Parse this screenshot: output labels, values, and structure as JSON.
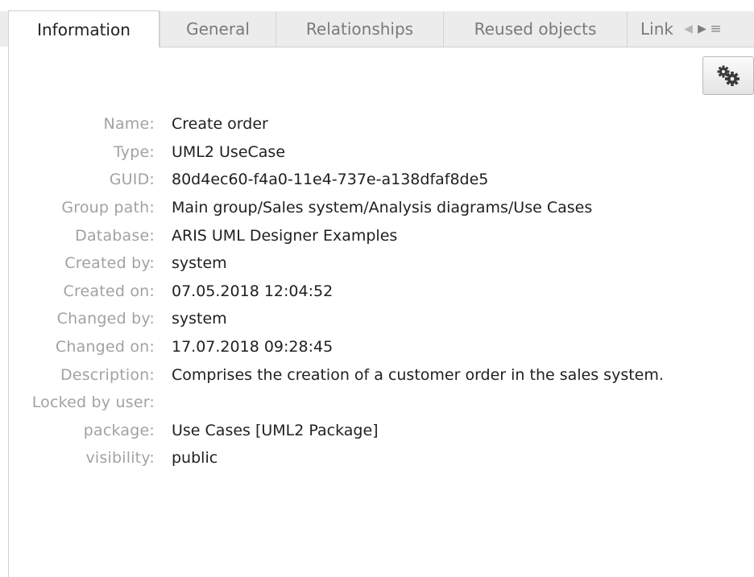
{
  "tabs": [
    {
      "label": "Information",
      "active": true
    },
    {
      "label": "General",
      "active": false
    },
    {
      "label": "Relationships",
      "active": false
    },
    {
      "label": "Reused objects",
      "active": false
    },
    {
      "label": "Link",
      "active": false
    }
  ],
  "tab_nav": {
    "prev_icon": "triangle-left-icon",
    "next_icon": "triangle-right-icon",
    "menu_icon": "hamburger-menu-icon"
  },
  "toolbar": {
    "settings_icon": "gears-icon"
  },
  "properties": [
    {
      "label": "Name:",
      "value": "Create order"
    },
    {
      "label": "Type:",
      "value": "UML2 UseCase"
    },
    {
      "label": "GUID:",
      "value": "80d4ec60-f4a0-11e4-737e-a138dfaf8de5"
    },
    {
      "label": "Group path:",
      "value": "Main group/Sales system/Analysis diagrams/Use Cases"
    },
    {
      "label": "Database:",
      "value": "ARIS UML Designer Examples"
    },
    {
      "label": "Created by:",
      "value": "system"
    },
    {
      "label": "Created on:",
      "value": "07.05.2018 12:04:52"
    },
    {
      "label": "Changed by:",
      "value": "system"
    },
    {
      "label": "Changed on:",
      "value": "17.07.2018 09:28:45"
    },
    {
      "label": "Description:",
      "value": "Comprises the creation of a customer order in the sales system."
    },
    {
      "label": "Locked by user:",
      "value": ""
    },
    {
      "label": "package:",
      "value": "Use Cases [UML2 Package]"
    },
    {
      "label": "visibility:",
      "value": "public"
    }
  ]
}
